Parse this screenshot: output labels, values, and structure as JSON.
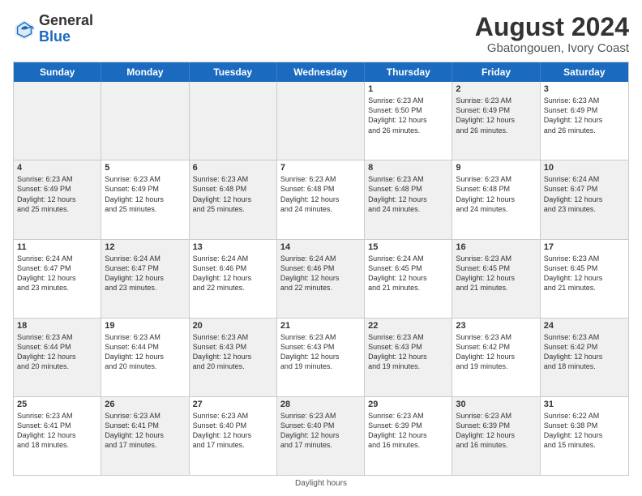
{
  "header": {
    "logo_general": "General",
    "logo_blue": "Blue",
    "month_title": "August 2024",
    "location": "Gbatongouen, Ivory Coast"
  },
  "days_of_week": [
    "Sunday",
    "Monday",
    "Tuesday",
    "Wednesday",
    "Thursday",
    "Friday",
    "Saturday"
  ],
  "weeks": [
    [
      {
        "day": "",
        "text": "",
        "shaded": true
      },
      {
        "day": "",
        "text": "",
        "shaded": true
      },
      {
        "day": "",
        "text": "",
        "shaded": true
      },
      {
        "day": "",
        "text": "",
        "shaded": true
      },
      {
        "day": "1",
        "text": "Sunrise: 6:23 AM\nSunset: 6:50 PM\nDaylight: 12 hours\nand 26 minutes.",
        "shaded": false
      },
      {
        "day": "2",
        "text": "Sunrise: 6:23 AM\nSunset: 6:49 PM\nDaylight: 12 hours\nand 26 minutes.",
        "shaded": true
      },
      {
        "day": "3",
        "text": "Sunrise: 6:23 AM\nSunset: 6:49 PM\nDaylight: 12 hours\nand 26 minutes.",
        "shaded": false
      }
    ],
    [
      {
        "day": "4",
        "text": "Sunrise: 6:23 AM\nSunset: 6:49 PM\nDaylight: 12 hours\nand 25 minutes.",
        "shaded": true
      },
      {
        "day": "5",
        "text": "Sunrise: 6:23 AM\nSunset: 6:49 PM\nDaylight: 12 hours\nand 25 minutes.",
        "shaded": false
      },
      {
        "day": "6",
        "text": "Sunrise: 6:23 AM\nSunset: 6:48 PM\nDaylight: 12 hours\nand 25 minutes.",
        "shaded": true
      },
      {
        "day": "7",
        "text": "Sunrise: 6:23 AM\nSunset: 6:48 PM\nDaylight: 12 hours\nand 24 minutes.",
        "shaded": false
      },
      {
        "day": "8",
        "text": "Sunrise: 6:23 AM\nSunset: 6:48 PM\nDaylight: 12 hours\nand 24 minutes.",
        "shaded": true
      },
      {
        "day": "9",
        "text": "Sunrise: 6:23 AM\nSunset: 6:48 PM\nDaylight: 12 hours\nand 24 minutes.",
        "shaded": false
      },
      {
        "day": "10",
        "text": "Sunrise: 6:24 AM\nSunset: 6:47 PM\nDaylight: 12 hours\nand 23 minutes.",
        "shaded": true
      }
    ],
    [
      {
        "day": "11",
        "text": "Sunrise: 6:24 AM\nSunset: 6:47 PM\nDaylight: 12 hours\nand 23 minutes.",
        "shaded": false
      },
      {
        "day": "12",
        "text": "Sunrise: 6:24 AM\nSunset: 6:47 PM\nDaylight: 12 hours\nand 23 minutes.",
        "shaded": true
      },
      {
        "day": "13",
        "text": "Sunrise: 6:24 AM\nSunset: 6:46 PM\nDaylight: 12 hours\nand 22 minutes.",
        "shaded": false
      },
      {
        "day": "14",
        "text": "Sunrise: 6:24 AM\nSunset: 6:46 PM\nDaylight: 12 hours\nand 22 minutes.",
        "shaded": true
      },
      {
        "day": "15",
        "text": "Sunrise: 6:24 AM\nSunset: 6:45 PM\nDaylight: 12 hours\nand 21 minutes.",
        "shaded": false
      },
      {
        "day": "16",
        "text": "Sunrise: 6:23 AM\nSunset: 6:45 PM\nDaylight: 12 hours\nand 21 minutes.",
        "shaded": true
      },
      {
        "day": "17",
        "text": "Sunrise: 6:23 AM\nSunset: 6:45 PM\nDaylight: 12 hours\nand 21 minutes.",
        "shaded": false
      }
    ],
    [
      {
        "day": "18",
        "text": "Sunrise: 6:23 AM\nSunset: 6:44 PM\nDaylight: 12 hours\nand 20 minutes.",
        "shaded": true
      },
      {
        "day": "19",
        "text": "Sunrise: 6:23 AM\nSunset: 6:44 PM\nDaylight: 12 hours\nand 20 minutes.",
        "shaded": false
      },
      {
        "day": "20",
        "text": "Sunrise: 6:23 AM\nSunset: 6:43 PM\nDaylight: 12 hours\nand 20 minutes.",
        "shaded": true
      },
      {
        "day": "21",
        "text": "Sunrise: 6:23 AM\nSunset: 6:43 PM\nDaylight: 12 hours\nand 19 minutes.",
        "shaded": false
      },
      {
        "day": "22",
        "text": "Sunrise: 6:23 AM\nSunset: 6:43 PM\nDaylight: 12 hours\nand 19 minutes.",
        "shaded": true
      },
      {
        "day": "23",
        "text": "Sunrise: 6:23 AM\nSunset: 6:42 PM\nDaylight: 12 hours\nand 19 minutes.",
        "shaded": false
      },
      {
        "day": "24",
        "text": "Sunrise: 6:23 AM\nSunset: 6:42 PM\nDaylight: 12 hours\nand 18 minutes.",
        "shaded": true
      }
    ],
    [
      {
        "day": "25",
        "text": "Sunrise: 6:23 AM\nSunset: 6:41 PM\nDaylight: 12 hours\nand 18 minutes.",
        "shaded": false
      },
      {
        "day": "26",
        "text": "Sunrise: 6:23 AM\nSunset: 6:41 PM\nDaylight: 12 hours\nand 17 minutes.",
        "shaded": true
      },
      {
        "day": "27",
        "text": "Sunrise: 6:23 AM\nSunset: 6:40 PM\nDaylight: 12 hours\nand 17 minutes.",
        "shaded": false
      },
      {
        "day": "28",
        "text": "Sunrise: 6:23 AM\nSunset: 6:40 PM\nDaylight: 12 hours\nand 17 minutes.",
        "shaded": true
      },
      {
        "day": "29",
        "text": "Sunrise: 6:23 AM\nSunset: 6:39 PM\nDaylight: 12 hours\nand 16 minutes.",
        "shaded": false
      },
      {
        "day": "30",
        "text": "Sunrise: 6:23 AM\nSunset: 6:39 PM\nDaylight: 12 hours\nand 16 minutes.",
        "shaded": true
      },
      {
        "day": "31",
        "text": "Sunrise: 6:22 AM\nSunset: 6:38 PM\nDaylight: 12 hours\nand 15 minutes.",
        "shaded": false
      }
    ]
  ],
  "footer": "Daylight hours"
}
